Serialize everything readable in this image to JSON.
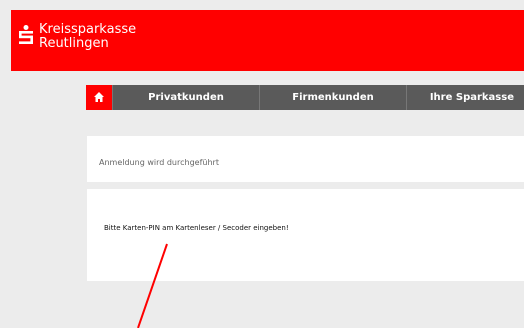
{
  "header": {
    "brand_line1": "Kreissparkasse",
    "brand_line2": "Reutlingen",
    "bg_color": "#ff0000",
    "logo_icon": "sparkasse-logo-icon"
  },
  "nav": {
    "home_icon": "home-icon",
    "items": [
      {
        "label": "Privatkunden"
      },
      {
        "label": "Firmenkunden"
      },
      {
        "label": "Ihre Sparkasse"
      }
    ],
    "bg_color": "#5a5a5a",
    "home_bg_color": "#ff0000"
  },
  "main": {
    "status_text": "Anmeldung wird durchgeführt",
    "instruction_text": "Bitte Karten-PIN am Kartenleser / Secoder eingeben!"
  },
  "annotation": {
    "arrow_color": "#ff0000"
  }
}
